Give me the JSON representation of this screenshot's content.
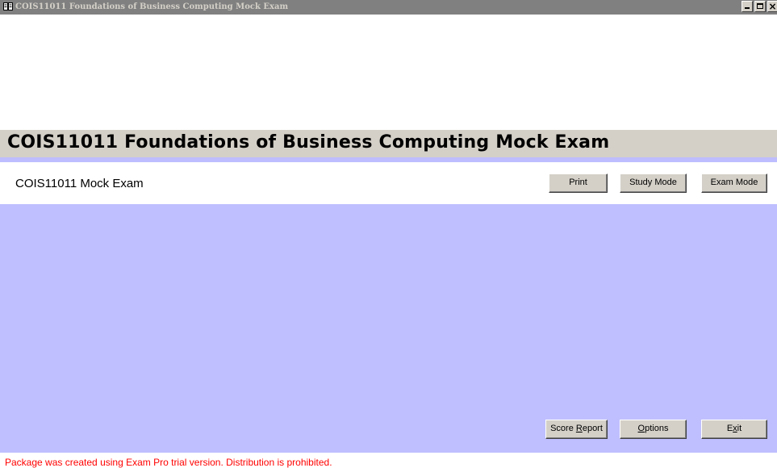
{
  "window": {
    "title": "COIS11011 Foundations of Business Computing Mock Exam",
    "icon": "book-icon",
    "controls": {
      "minimize_icon": "minimize-icon",
      "maximize_icon": "maximize-icon",
      "close_label": "×"
    }
  },
  "header": {
    "title": "COIS11011 Foundations of Business Computing Mock Exam"
  },
  "exam": {
    "name": "COIS11011 Mock Exam"
  },
  "toolbar": {
    "print_label": "Print",
    "study_mode_label": "Study Mode",
    "exam_mode_label": "Exam Mode"
  },
  "bottom_bar": {
    "score_report_pre": "Score ",
    "score_report_mnemonic": "R",
    "score_report_post": "eport",
    "options_mnemonic": "O",
    "options_post": "ptions",
    "exit_pre": "E",
    "exit_mnemonic": "x",
    "exit_post": "it"
  },
  "footer": {
    "notice": "Package was created using Exam Pro trial version. Distribution is prohibited."
  },
  "colors": {
    "content_bg": "#bfbfff",
    "stripe": "#bdbdff",
    "header_band": "#d4d0c8",
    "notice_text": "#ff0000"
  }
}
